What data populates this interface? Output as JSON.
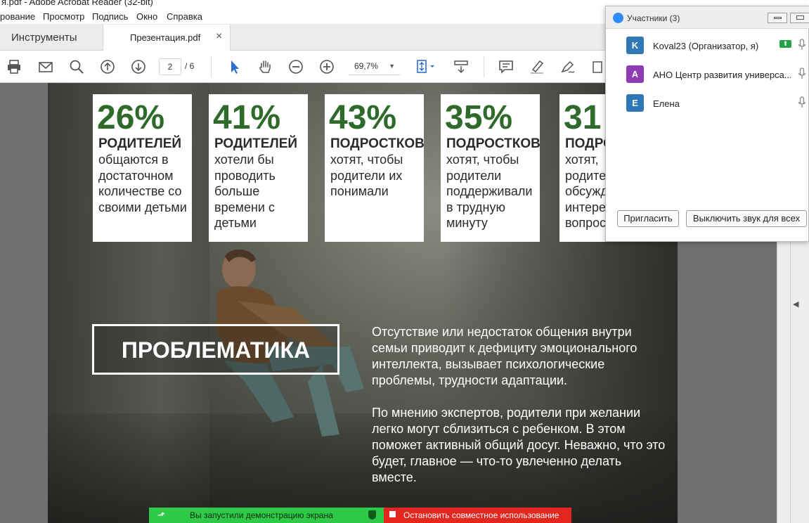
{
  "window": {
    "title": "я.pdf - Adobe Acrobat Reader (32-bit)"
  },
  "menu": [
    "рование",
    "Просмотр",
    "Подпись",
    "Окно",
    "Справка"
  ],
  "tabs": {
    "tools": "Инструменты",
    "document": "Презентация.pdf",
    "close": "×"
  },
  "toolbar": {
    "page_current": "2",
    "page_total": "/ 6",
    "zoom": "69,7%"
  },
  "slide": {
    "stats": [
      {
        "percent": "26%",
        "who": "РОДИТЕЛЕЙ",
        "text": "общаются в достаточном количестве со своими детьми"
      },
      {
        "percent": "41%",
        "who": "РОДИТЕЛЕЙ",
        "text": "хотели бы проводить больше времени с детьми"
      },
      {
        "percent": "43%",
        "who": "ПОДРОСТКОВ",
        "text": "хотят, чтобы родители их понимали"
      },
      {
        "percent": "35%",
        "who": "ПОДРОСТКОВ",
        "text": "хотят, чтобы родители поддерживали в трудную минуту"
      },
      {
        "percent": "31",
        "who": "ПОДРО",
        "text": "хотят, родите обсужд интере вопрос"
      }
    ],
    "heading": "ПРОБЛЕМАТИКА",
    "paragraph1": "Отсутствие или недостаток общения внутри семьи приводит к дефициту эмоционального интеллекта, вызывает психологические проблемы, трудности адаптации.",
    "paragraph2": "По мнению экспертов, родители при желании легко могут сблизиться с ребенком. В этом поможет активный общий досуг. Неважно, что это будет, главное — что-то увлеченно делать вместе."
  },
  "participants": {
    "title": "Участники (3)",
    "list": [
      {
        "initial": "K",
        "name": "Koval23 (Организатор, я)",
        "color": "#2f78b8"
      },
      {
        "initial": "А",
        "name": "АНО Центр развития универса...",
        "color": "#8e3bb5"
      },
      {
        "initial": "Е",
        "name": "Елена",
        "color": "#2f78b8"
      }
    ],
    "invite": "Пригласить",
    "mute_all": "Выключить звук для всех"
  },
  "share_bar": {
    "status": "Вы запустили демонстрацию экрана",
    "stop": "Остановить совместное использование"
  }
}
